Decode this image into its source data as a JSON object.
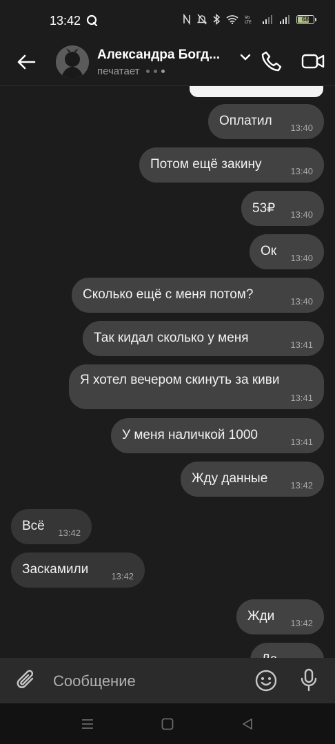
{
  "status_bar": {
    "time": "13:42",
    "battery": "68",
    "battery_level": 0.68
  },
  "header": {
    "contact_name": "Александра Богд...",
    "status": "печатает"
  },
  "messages": [
    {
      "dir": "out",
      "text": "Оплатил",
      "time": "13:40"
    },
    {
      "dir": "out",
      "text": "Потом ещё закину",
      "time": "13:40"
    },
    {
      "dir": "out",
      "text": "53₽",
      "time": "13:40"
    },
    {
      "dir": "out",
      "text": "Ок",
      "time": "13:40"
    },
    {
      "dir": "out",
      "text": "Сколько ещё с меня потом?",
      "time": "13:40"
    },
    {
      "dir": "out",
      "text": "Так  кидал сколько у меня",
      "time": "13:41"
    },
    {
      "dir": "out",
      "text": "Я хотел вечером скинуть за киви",
      "time": "13:41"
    },
    {
      "dir": "out",
      "text": "У меня наличкой 1000",
      "time": "13:41"
    },
    {
      "dir": "out",
      "text": "Жду данные",
      "time": "13:42"
    },
    {
      "dir": "in",
      "text": "Всё",
      "time": "13:42"
    },
    {
      "dir": "in",
      "text": "Заскамили",
      "time": "13:42"
    },
    {
      "dir": "out",
      "text": "Жди",
      "time": "13:42"
    },
    {
      "dir": "out",
      "text": "Да",
      "time": ""
    }
  ],
  "composer": {
    "placeholder": "Сообщение"
  },
  "colors": {
    "outgoing_bubble": "#424242",
    "incoming_bubble": "#363636",
    "background": "#1c1c1c"
  },
  "icons": [
    "back-arrow-icon",
    "chevron-down-icon",
    "phone-icon",
    "video-camera-icon",
    "paperclip-icon",
    "smile-icon",
    "microphone-icon",
    "menu-nav-icon",
    "home-nav-icon",
    "back-nav-icon"
  ]
}
